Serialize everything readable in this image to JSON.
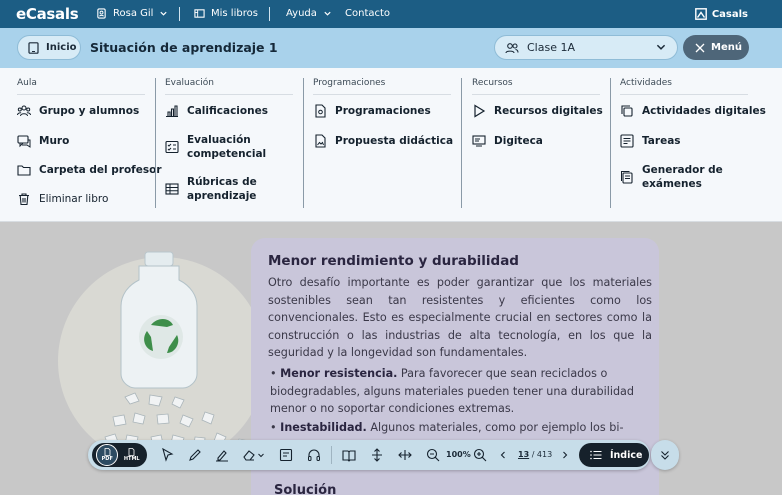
{
  "topbar": {
    "logo": "eCasals",
    "user": "Rosa Gil",
    "my_books": "Mis libros",
    "help": "Ayuda",
    "contact": "Contacto",
    "brand": "Casals"
  },
  "subbar": {
    "home_label": "Inicio",
    "title": "Situación de aprendizaje 1",
    "class_selected": "Clase 1A",
    "menu_label": "Menú"
  },
  "mega_menu": {
    "columns": [
      {
        "heading": "Aula",
        "items": [
          {
            "label": "Grupo y alumnos",
            "icon": "group-icon"
          },
          {
            "label": "Muro",
            "icon": "chat-icon"
          },
          {
            "label": "Carpeta del profesor",
            "icon": "folder-icon"
          },
          {
            "label": "Eliminar libro",
            "icon": "trash-icon"
          }
        ]
      },
      {
        "heading": "Evaluación",
        "items": [
          {
            "label": "Calificaciones",
            "icon": "bar-chart-icon"
          },
          {
            "label": "Evaluación competencial",
            "icon": "checklist-icon"
          },
          {
            "label": "Rúbricas de aprendizaje",
            "icon": "table-icon"
          }
        ]
      },
      {
        "heading": "Programaciones",
        "items": [
          {
            "label": "Programaciones",
            "icon": "document-gear-icon"
          },
          {
            "label": "Propuesta didáctica",
            "icon": "document-image-icon"
          }
        ]
      },
      {
        "heading": "Recursos",
        "items": [
          {
            "label": "Recursos digitales",
            "icon": "play-icon"
          },
          {
            "label": "Digiteca",
            "icon": "library-icon"
          }
        ]
      },
      {
        "heading": "Actividades",
        "items": [
          {
            "label": "Actividades digitales",
            "icon": "copy-icon"
          },
          {
            "label": "Tareas",
            "icon": "task-list-icon"
          },
          {
            "label": "Generador de exámenes",
            "icon": "exam-icon"
          }
        ]
      }
    ]
  },
  "book": {
    "heading": "Menor rendimiento y durabilidad",
    "paragraph": "Otro desafío importante es poder garantizar que los materiales sostenibles sean tan resistentes y eficientes como los convencionales. Esto es especialmente crucial en sectores como la construcción o las industrias de alta tecnología, en los que la seguridad y la longevidad son fundamentales.",
    "bullets": [
      {
        "term": "Menor resistencia.",
        "text": " Para favorecer que sean reciclados o biodegradables, alguns materiales pueden tener una durabilidad menor o no soportar condiciones extremas."
      },
      {
        "term": "Inestabilidad.",
        "text": " Algunos materiales, como por ejemplo los bi-"
      }
    ],
    "next_heading": "Solución"
  },
  "toolbar": {
    "format_pdf": "PDF",
    "format_html": "HTML",
    "zoom": "100%",
    "current_page": "13",
    "total_pages": "/ 413",
    "index_label": "Índice"
  }
}
